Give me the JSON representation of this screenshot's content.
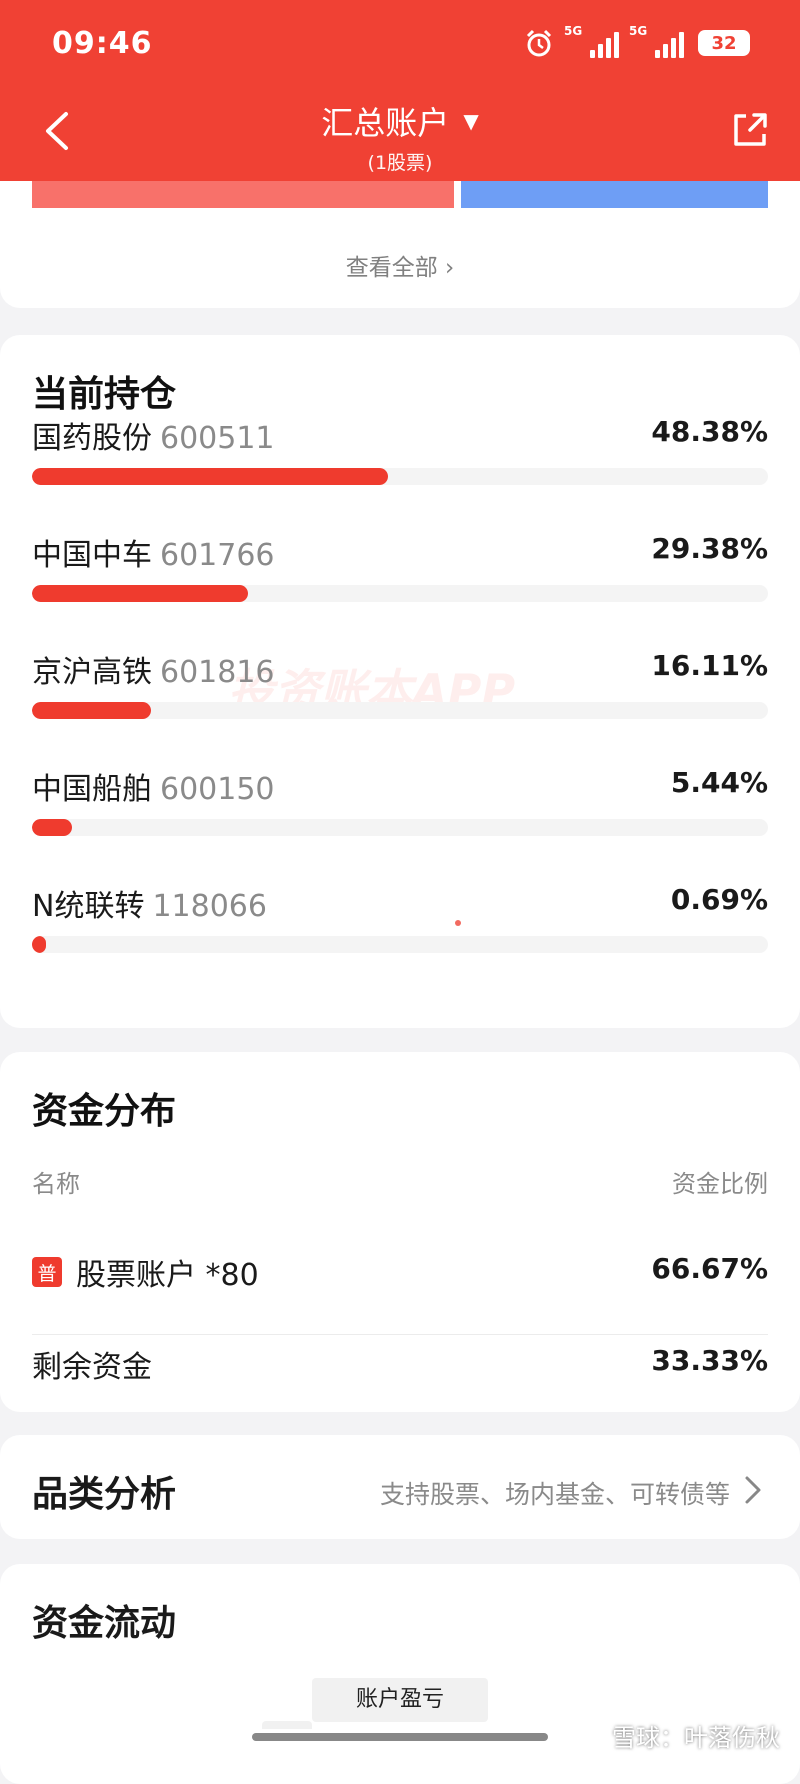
{
  "status_bar": {
    "time": "09:46",
    "signal1_label": "5G",
    "signal2_label": "5G",
    "battery": "32"
  },
  "header": {
    "title": "汇总账户",
    "title_caret": "▼",
    "subtitle": "(1股票)",
    "background": "#f04134"
  },
  "top_card": {
    "view_all": "查看全部 ›"
  },
  "holdings": {
    "title": "当前持仓",
    "items": [
      {
        "name": "国药股份",
        "code": "600511",
        "pct": "48.38%",
        "ratio": 0.4838
      },
      {
        "name": "中国中车",
        "code": "601766",
        "pct": "29.38%",
        "ratio": 0.2938
      },
      {
        "name": "京沪高铁",
        "code": "601816",
        "pct": "16.11%",
        "ratio": 0.1611
      },
      {
        "name": "中国船舶",
        "code": "600150",
        "pct": "5.44%",
        "ratio": 0.0544
      },
      {
        "name": "N统联转",
        "code": "118066",
        "pct": "0.69%",
        "ratio": 0.0069
      }
    ],
    "watermark": "投资账本APP",
    "bar_color": "#ef3b2e"
  },
  "funds": {
    "title": "资金分布",
    "col_name": "名称",
    "col_ratio": "资金比例",
    "rows": [
      {
        "badge": "普",
        "name": "股票账户 *80",
        "pct": "66.67%"
      },
      {
        "badge": "",
        "name": "剩余资金",
        "pct": "33.33%"
      }
    ]
  },
  "category": {
    "title": "品类分析",
    "desc": "支持股票、场内基金、可转债等"
  },
  "flow": {
    "title": "资金流动",
    "tab": "账户盈亏"
  },
  "credit": "雪球：叶落伤秋"
}
